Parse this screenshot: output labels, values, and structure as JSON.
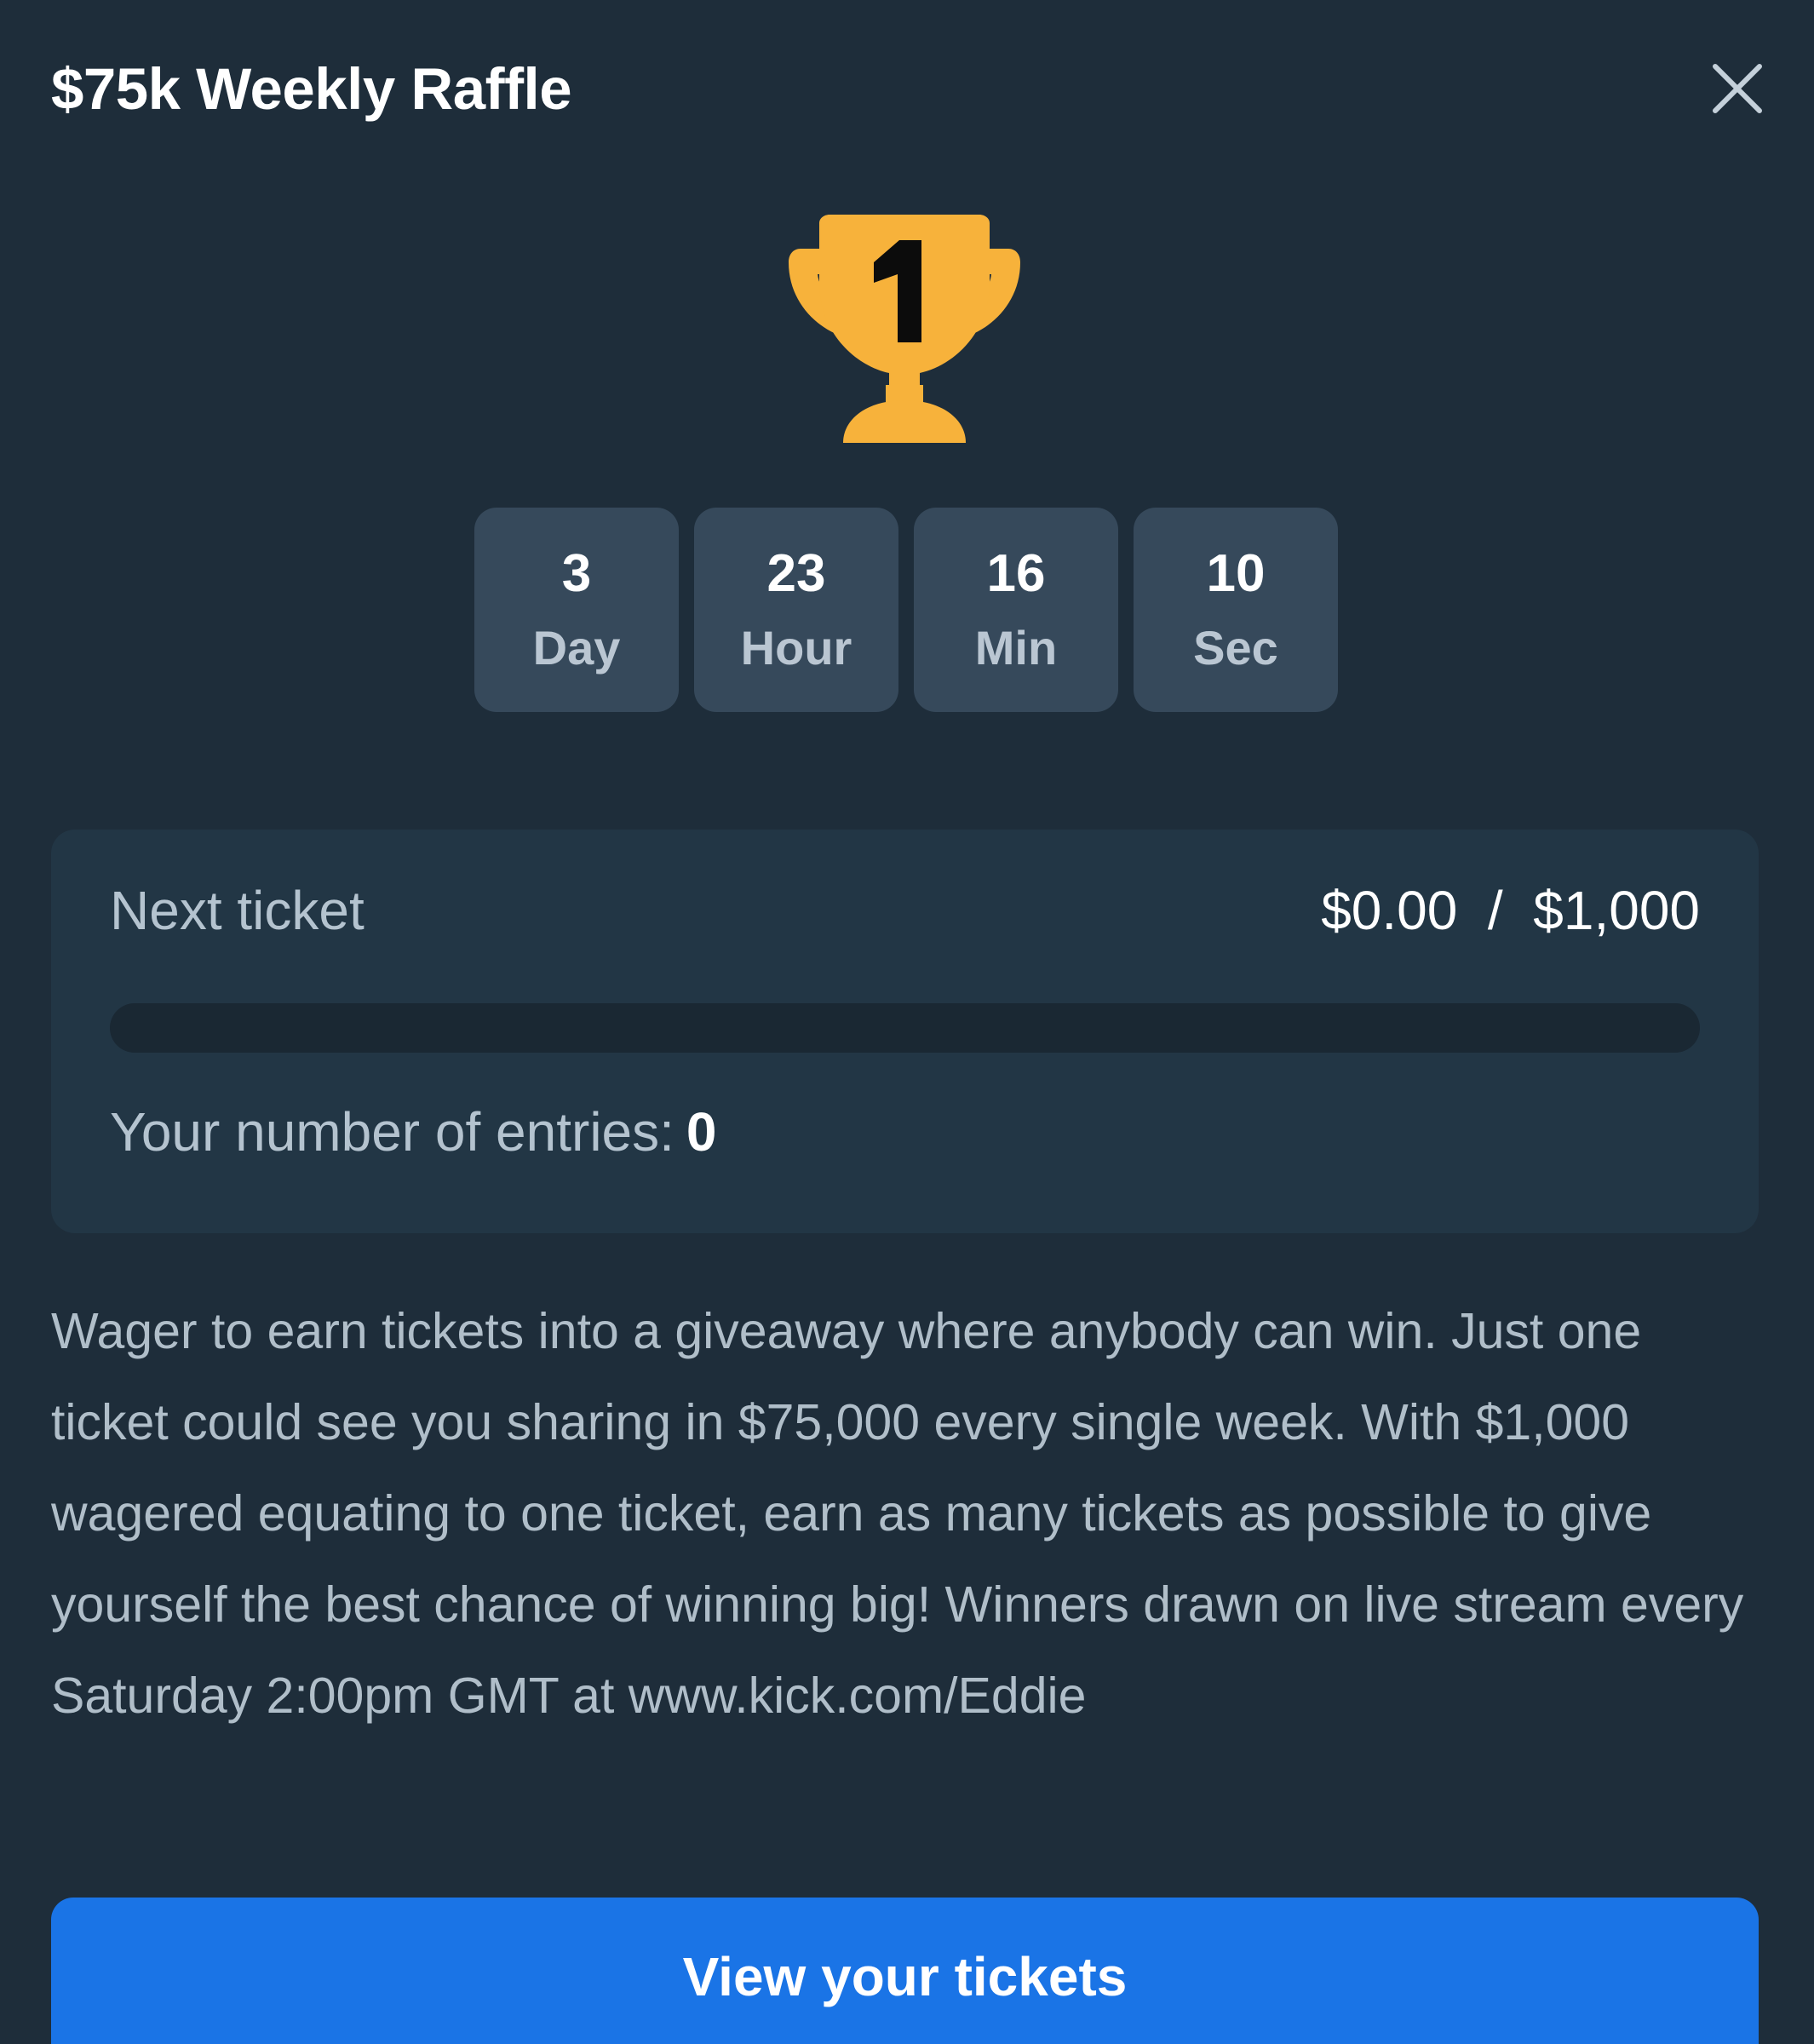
{
  "modal": {
    "title": "$75k Weekly Raffle",
    "close_icon": "close-icon"
  },
  "trophy": {
    "icon": "trophy-icon",
    "badge_text": "1",
    "color": "#f7b23b"
  },
  "countdown": [
    {
      "value": "3",
      "unit": "Day"
    },
    {
      "value": "23",
      "unit": "Hour"
    },
    {
      "value": "16",
      "unit": "Min"
    },
    {
      "value": "10",
      "unit": "Sec"
    }
  ],
  "ticket": {
    "label": "Next ticket",
    "amounts": "$0.00  /  $1,000",
    "progress_percent": 0,
    "entries_label": "Your number of entries:",
    "entries_count": "0"
  },
  "description": "Wager to earn tickets into a giveaway where anybody can win. Just one ticket could see you sharing in $75,000 every single week. With $1,000 wagered equating to one ticket, earn as many tickets as possible to give yourself the best chance of winning big! Winners drawn on live stream every Saturday 2:00pm GMT at www.kick.com/Eddie",
  "cta": {
    "label": "View your tickets",
    "color": "#1a74e6"
  },
  "colors": {
    "background": "#1e2d3a",
    "card": "#223645",
    "countdown_box": "#36495b"
  }
}
